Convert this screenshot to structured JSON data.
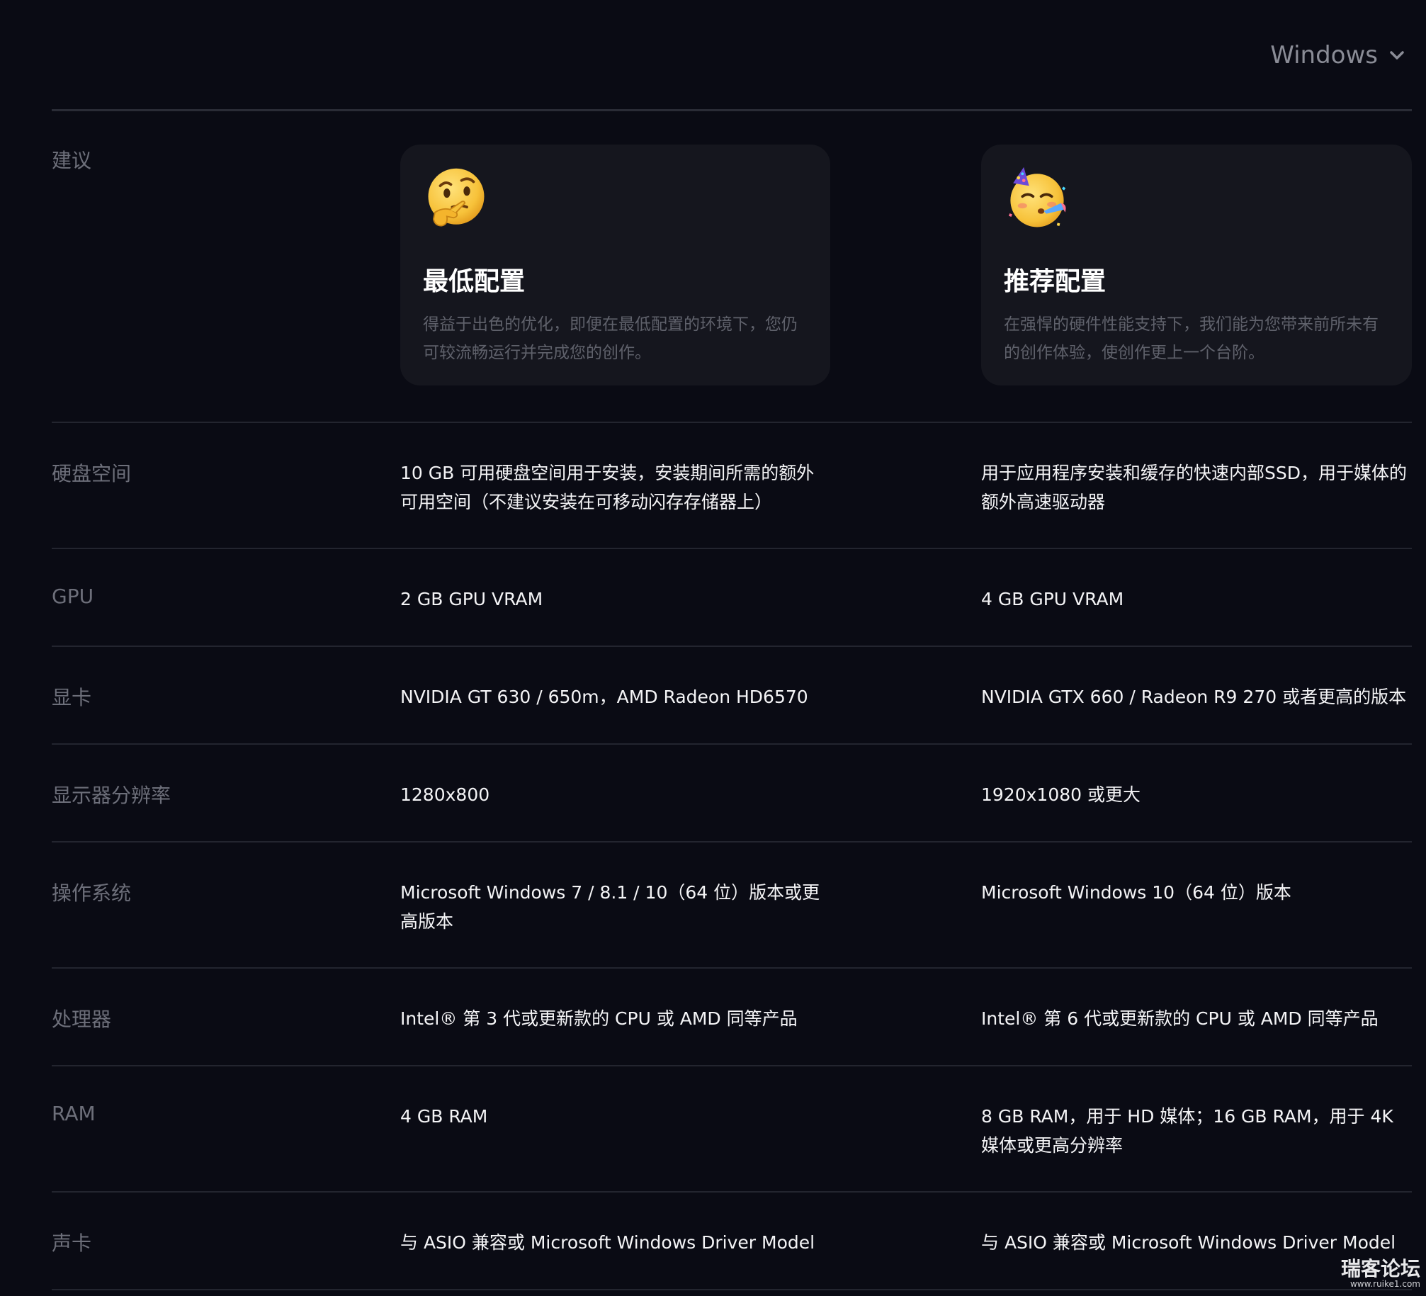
{
  "os_selector": {
    "value": "Windows"
  },
  "recommend": {
    "label": "建议",
    "min": {
      "icon": "thinking-face-icon",
      "title": "最低配置",
      "desc": "得益于出色的优化，即便在最低配置的环境下，您仍可较流畅运行并完成您的创作。"
    },
    "rec": {
      "icon": "partying-face-icon",
      "title": "推荐配置",
      "desc": "在强悍的硬件性能支持下，我们能为您带来前所未有的创作体验，使创作更上一个台阶。"
    }
  },
  "specs": [
    {
      "label": "硬盘空间",
      "min": "10 GB 可用硬盘空间用于安装，安装期间所需的额外可用空间（不建议安装在可移动闪存存储器上）",
      "rec": "用于应用程序安装和缓存的快速内部SSD，用于媒体的额外高速驱动器"
    },
    {
      "label": "GPU",
      "min": "2 GB GPU VRAM",
      "rec": "4 GB GPU VRAM"
    },
    {
      "label": "显卡",
      "min": "NVIDIA GT 630 / 650m，AMD Radeon HD6570",
      "rec": "NVIDIA GTX 660 / Radeon R9 270 或者更高的版本"
    },
    {
      "label": "显示器分辨率",
      "min": "1280x800",
      "rec": "1920x1080 或更大"
    },
    {
      "label": "操作系统",
      "min": "Microsoft Windows 7 / 8.1 / 10（64 位）版本或更高版本",
      "rec": "Microsoft Windows 10（64 位）版本"
    },
    {
      "label": "处理器",
      "min": "Intel® 第 3 代或更新款的 CPU 或 AMD 同等产品",
      "rec": "Intel® 第 6 代或更新款的 CPU 或 AMD 同等产品"
    },
    {
      "label": "RAM",
      "min": "4 GB RAM",
      "rec": "8 GB RAM，用于 HD 媒体；16 GB RAM，用于 4K 媒体或更高分辨率"
    },
    {
      "label": "声卡",
      "min": "与 ASIO 兼容或 Microsoft Windows Driver Model",
      "rec": "与 ASIO 兼容或 Microsoft Windows Driver Model"
    }
  ],
  "watermark": {
    "text": "瑞客论坛",
    "url": "www.ruike1.com"
  },
  "colors": {
    "background": "#0a0b14",
    "card": "#15161e",
    "label": "#6d6f7a",
    "divider": "#23252f"
  }
}
